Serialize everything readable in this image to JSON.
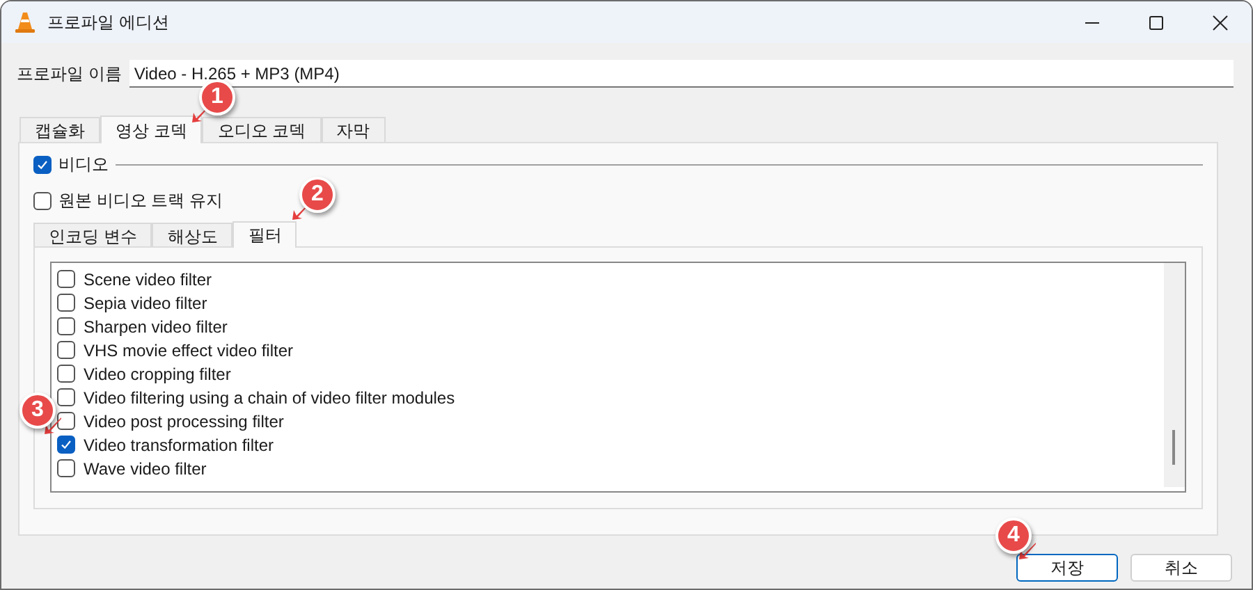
{
  "window": {
    "title": "프로파일 에디션"
  },
  "profile_name": {
    "label": "프로파일 이름",
    "value": "Video - H.265 + MP3 (MP4)"
  },
  "tabs": [
    {
      "label": "캡슐화",
      "selected": false
    },
    {
      "label": "영상 코덱",
      "selected": true
    },
    {
      "label": "오디오 코덱",
      "selected": false
    },
    {
      "label": "자막",
      "selected": false
    }
  ],
  "video": {
    "label": "비디오",
    "checked": true
  },
  "keep_original": {
    "label": "원본 비디오 트랙 유지",
    "checked": false
  },
  "subtabs": [
    {
      "label": "인코딩 변수",
      "selected": false
    },
    {
      "label": "해상도",
      "selected": false
    },
    {
      "label": "필터",
      "selected": true
    }
  ],
  "filters": [
    {
      "label": "Scene video filter",
      "checked": false
    },
    {
      "label": "Sepia video filter",
      "checked": false
    },
    {
      "label": "Sharpen video filter",
      "checked": false
    },
    {
      "label": "VHS movie effect video filter",
      "checked": false
    },
    {
      "label": "Video cropping filter",
      "checked": false
    },
    {
      "label": "Video filtering using a chain of video filter modules",
      "checked": false
    },
    {
      "label": "Video post processing filter",
      "checked": false
    },
    {
      "label": "Video transformation filter",
      "checked": true
    },
    {
      "label": "Wave video filter",
      "checked": false
    }
  ],
  "buttons": [
    {
      "label": "저장",
      "kind": "default"
    },
    {
      "label": "취소",
      "kind": "normal"
    }
  ],
  "annotations": [
    {
      "label": "1"
    },
    {
      "label": "2"
    },
    {
      "label": "3"
    },
    {
      "label": "4"
    }
  ]
}
